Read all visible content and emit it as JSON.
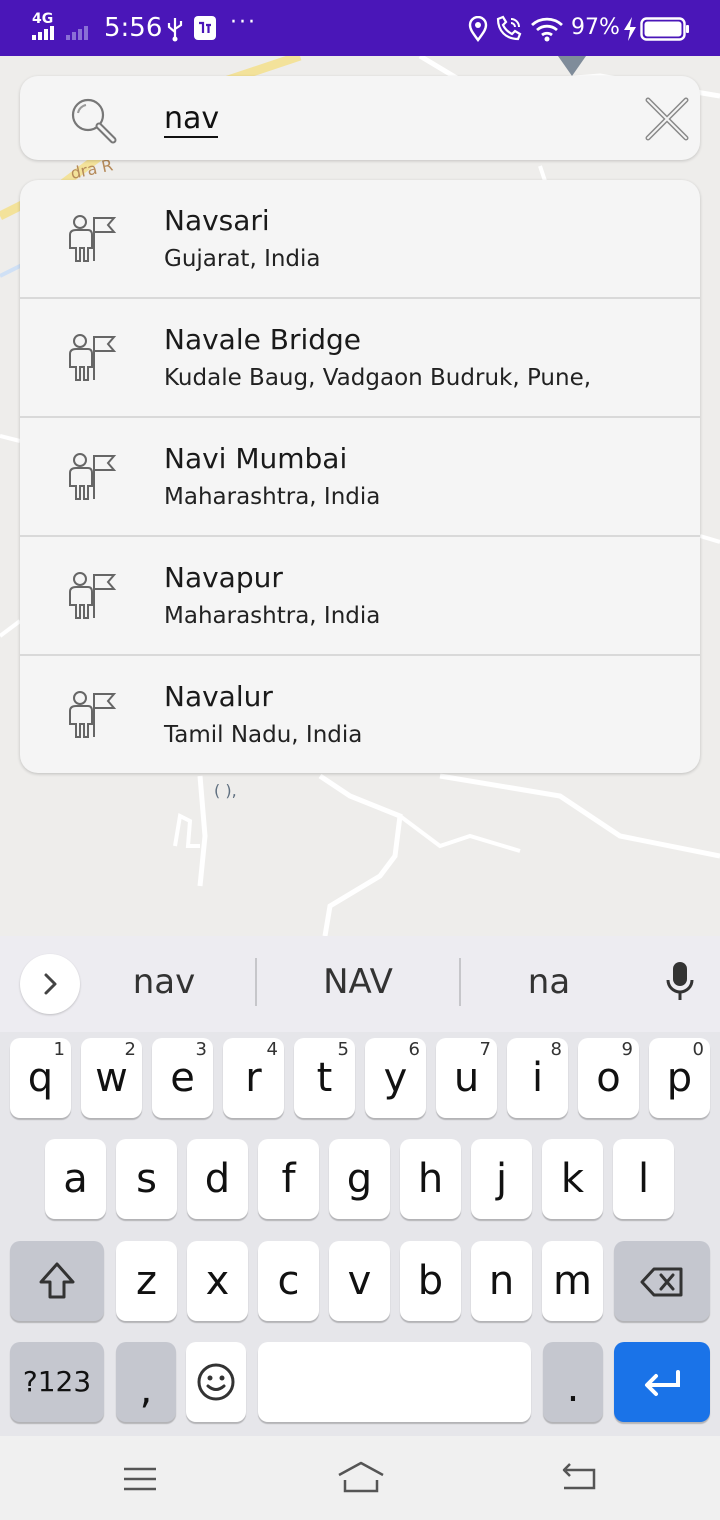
{
  "status_bar": {
    "network": "4G",
    "time": "5:56",
    "more": "···",
    "battery": "97%"
  },
  "search": {
    "query": "nav",
    "placeholder": ""
  },
  "results": [
    {
      "title": "Navsari",
      "subtitle": "Gujarat, India"
    },
    {
      "title": "Navale Bridge",
      "subtitle": "Kudale Baug, Vadgaon Budruk, Pune,"
    },
    {
      "title": "Navi Mumbai",
      "subtitle": "Maharashtra, India"
    },
    {
      "title": "Navapur",
      "subtitle": "Maharashtra, India"
    },
    {
      "title": "Navalur",
      "subtitle": "Tamil Nadu, India"
    }
  ],
  "map": {
    "label_road": "dra R",
    "label_small": "( ),"
  },
  "keyboard": {
    "suggestions": [
      "nav",
      "NAV",
      "na"
    ],
    "row1": [
      {
        "k": "q",
        "h": "1"
      },
      {
        "k": "w",
        "h": "2"
      },
      {
        "k": "e",
        "h": "3"
      },
      {
        "k": "r",
        "h": "4"
      },
      {
        "k": "t",
        "h": "5"
      },
      {
        "k": "y",
        "h": "6"
      },
      {
        "k": "u",
        "h": "7"
      },
      {
        "k": "i",
        "h": "8"
      },
      {
        "k": "o",
        "h": "9"
      },
      {
        "k": "p",
        "h": "0"
      }
    ],
    "row2": [
      "a",
      "s",
      "d",
      "f",
      "g",
      "h",
      "j",
      "k",
      "l"
    ],
    "row3": [
      "z",
      "x",
      "c",
      "v",
      "b",
      "n",
      "m"
    ],
    "symbols_label": "?123",
    "comma_label": ",",
    "period_label": "."
  },
  "colors": {
    "status_bar": "#4a16b8",
    "enter_key": "#1a73e8",
    "map_background": "#eeedeb"
  }
}
